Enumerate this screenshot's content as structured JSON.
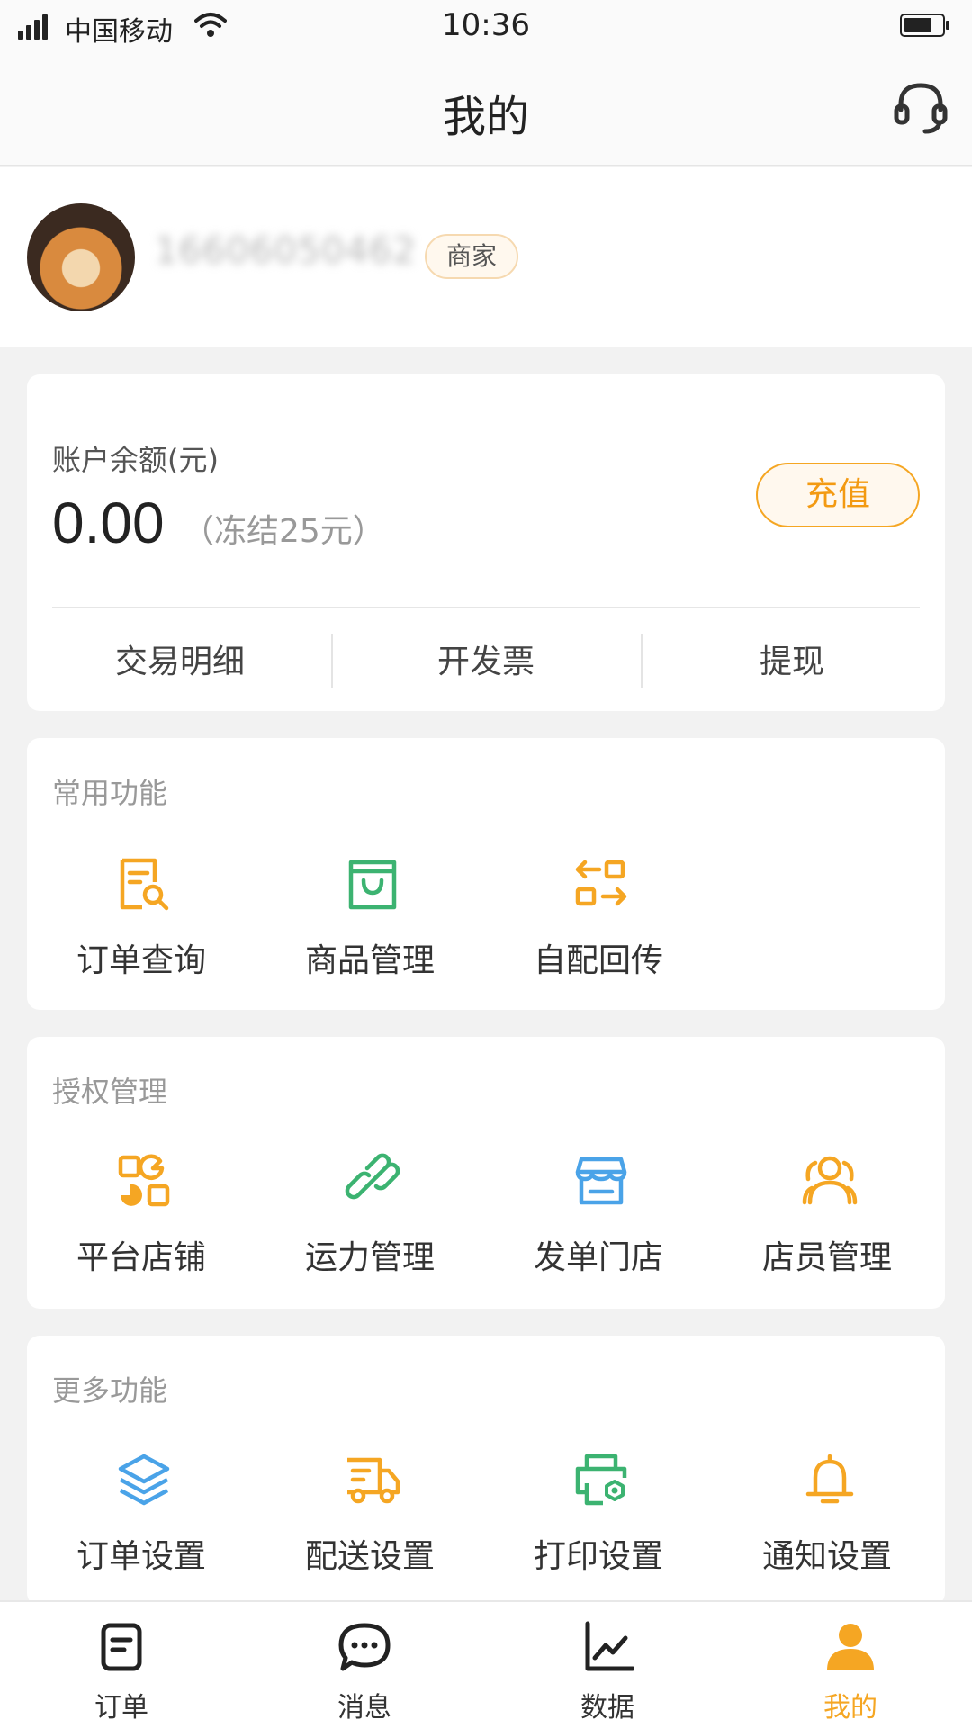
{
  "status_bar": {
    "carrier": "中国移动",
    "time": "10:36"
  },
  "nav": {
    "title": "我的",
    "customer_service_icon": "headset-icon"
  },
  "profile": {
    "phone": "16606050462",
    "badge": "商家"
  },
  "balance": {
    "label": "账户余额(元)",
    "amount": "0.00",
    "frozen": "（冻结25元）",
    "recharge_label": "充值",
    "actions": [
      "交易明细",
      "开发票",
      "提现"
    ]
  },
  "common": {
    "title": "常用功能",
    "items": [
      {
        "label": "订单查询",
        "icon": "order-search-icon",
        "color": "#f5a623"
      },
      {
        "label": "商品管理",
        "icon": "shopping-bag-icon",
        "color": "#3cb371"
      },
      {
        "label": "自配回传",
        "icon": "swap-icon",
        "color": "#f5a623"
      }
    ]
  },
  "auth": {
    "title": "授权管理",
    "items": [
      {
        "label": "平台店铺",
        "icon": "platform-store-icon",
        "color": "#f5a623"
      },
      {
        "label": "运力管理",
        "icon": "link-icon",
        "color": "#3cb371"
      },
      {
        "label": "发单门店",
        "icon": "storefront-icon",
        "color": "#4aa3e8"
      },
      {
        "label": "店员管理",
        "icon": "staff-icon",
        "color": "#f5a623"
      }
    ]
  },
  "more": {
    "title": "更多功能",
    "items": [
      {
        "label": "订单设置",
        "icon": "layers-icon",
        "color": "#4aa3e8"
      },
      {
        "label": "配送设置",
        "icon": "delivery-truck-icon",
        "color": "#f5a623"
      },
      {
        "label": "打印设置",
        "icon": "printer-icon",
        "color": "#3cb371"
      },
      {
        "label": "通知设置",
        "icon": "bell-icon",
        "color": "#f5a623"
      }
    ]
  },
  "tabs": [
    {
      "label": "订单",
      "icon": "order-tab-icon",
      "active": false
    },
    {
      "label": "消息",
      "icon": "message-tab-icon",
      "active": false
    },
    {
      "label": "数据",
      "icon": "chart-tab-icon",
      "active": false
    },
    {
      "label": "我的",
      "icon": "person-tab-icon",
      "active": true
    }
  ],
  "colors": {
    "accent": "#f5a623",
    "green": "#3cb371",
    "blue": "#4aa3e8",
    "background": "#f2f2f2"
  }
}
